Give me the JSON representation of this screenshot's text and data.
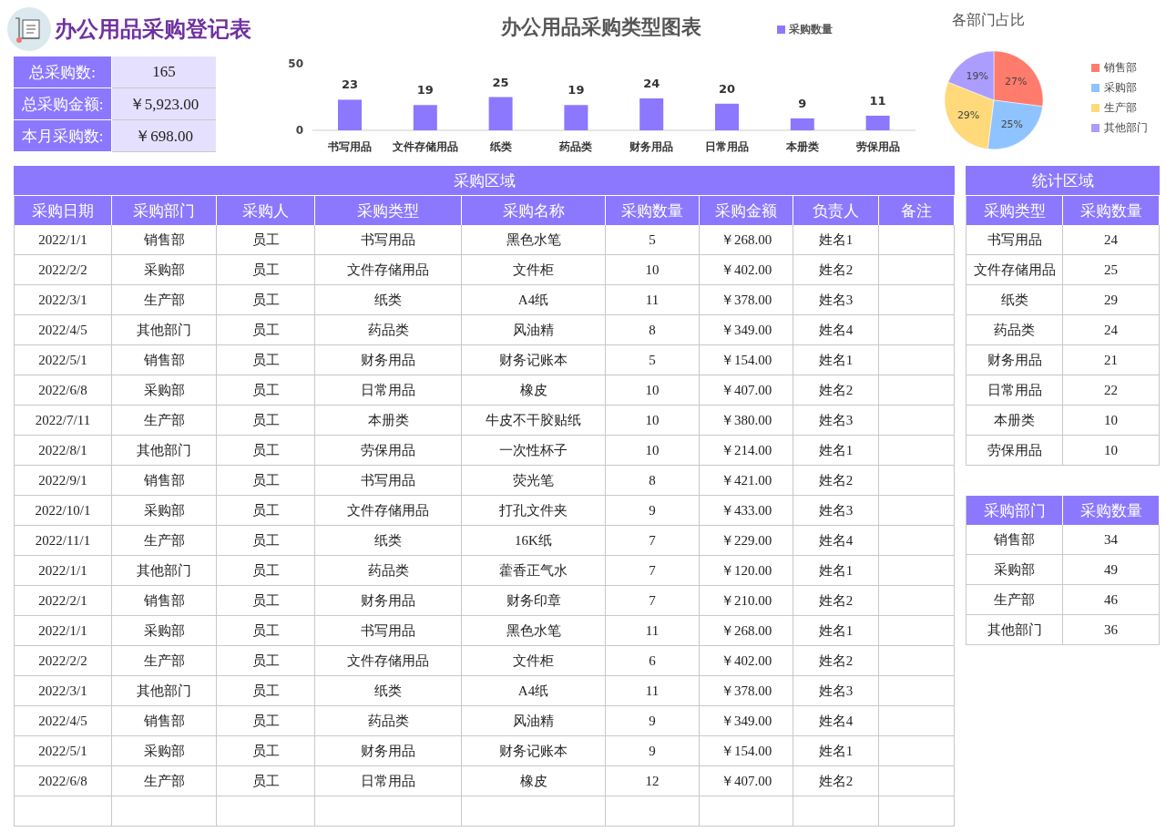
{
  "title": "办公用品采购登记表",
  "summary": [
    {
      "label": "总采购数:",
      "value": "165"
    },
    {
      "label": "总采购金额:",
      "value": "￥5,923.00"
    },
    {
      "label": "本月采购数:",
      "value": "￥698.00"
    }
  ],
  "bar_chart": {
    "chart_data": {
      "type": "bar",
      "title": "办公用品采购类型图表",
      "categories": [
        "书写用品",
        "文件存储用品",
        "纸类",
        "药品类",
        "财务用品",
        "日常用品",
        "本册类",
        "劳保用品"
      ],
      "series": [
        {
          "name": "采购数量",
          "color": "#8c78ff",
          "values": [
            23,
            19,
            25,
            19,
            24,
            20,
            9,
            11
          ]
        }
      ],
      "ylim": [
        0,
        50
      ],
      "yticks": [
        0,
        50
      ],
      "data_labels": true
    }
  },
  "pie_chart": {
    "chart_data": {
      "type": "pie",
      "title": "各部门占比",
      "categories": [
        "销售部",
        "采购部",
        "生产部",
        "其他部门"
      ],
      "values": [
        27,
        25,
        29,
        19
      ],
      "colors": [
        "#ff7b6b",
        "#8fc3ff",
        "#ffd97a",
        "#ab9cff"
      ],
      "value_labels": [
        "27%",
        "25%",
        "29%",
        "19%"
      ]
    }
  },
  "main_table": {
    "title": "采购区域",
    "columns": [
      "采购日期",
      "采购部门",
      "采购人",
      "采购类型",
      "采购名称",
      "采购数量",
      "采购金额",
      "负责人",
      "备注"
    ],
    "rows": [
      [
        "2022/1/1",
        "销售部",
        "员工",
        "书写用品",
        "黑色水笔",
        "5",
        "￥268.00",
        "姓名1"
      ],
      [
        "2022/2/2",
        "采购部",
        "员工",
        "文件存储用品",
        "文件柜",
        "10",
        "￥402.00",
        "姓名2"
      ],
      [
        "2022/3/1",
        "生产部",
        "员工",
        "纸类",
        "A4纸",
        "11",
        "￥378.00",
        "姓名3"
      ],
      [
        "2022/4/5",
        "其他部门",
        "员工",
        "药品类",
        "风油精",
        "8",
        "￥349.00",
        "姓名4"
      ],
      [
        "2022/5/1",
        "销售部",
        "员工",
        "财务用品",
        "财务记账本",
        "5",
        "￥154.00",
        "姓名1"
      ],
      [
        "2022/6/8",
        "采购部",
        "员工",
        "日常用品",
        "橡皮",
        "10",
        "￥407.00",
        "姓名2"
      ],
      [
        "2022/7/11",
        "生产部",
        "员工",
        "本册类",
        "牛皮不干胶贴纸",
        "10",
        "￥380.00",
        "姓名3"
      ],
      [
        "2022/8/1",
        "其他部门",
        "员工",
        "劳保用品",
        "一次性杯子",
        "10",
        "￥214.00",
        "姓名1"
      ],
      [
        "2022/9/1",
        "销售部",
        "员工",
        "书写用品",
        "荧光笔",
        "8",
        "￥421.00",
        "姓名2"
      ],
      [
        "2022/10/1",
        "采购部",
        "员工",
        "文件存储用品",
        "打孔文件夹",
        "9",
        "￥433.00",
        "姓名3"
      ],
      [
        "2022/11/1",
        "生产部",
        "员工",
        "纸类",
        "16K纸",
        "7",
        "￥229.00",
        "姓名4"
      ],
      [
        "2022/1/1",
        "其他部门",
        "员工",
        "药品类",
        "藿香正气水",
        "7",
        "￥120.00",
        "姓名1"
      ],
      [
        "2022/2/1",
        "销售部",
        "员工",
        "财务用品",
        "财务印章",
        "7",
        "￥210.00",
        "姓名2"
      ],
      [
        "2022/1/1",
        "采购部",
        "员工",
        "书写用品",
        "黑色水笔",
        "11",
        "￥268.00",
        "姓名1"
      ],
      [
        "2022/2/2",
        "生产部",
        "员工",
        "文件存储用品",
        "文件柜",
        "6",
        "￥402.00",
        "姓名2"
      ],
      [
        "2022/3/1",
        "其他部门",
        "员工",
        "纸类",
        "A4纸",
        "11",
        "￥378.00",
        "姓名3"
      ],
      [
        "2022/4/5",
        "销售部",
        "员工",
        "药品类",
        "风油精",
        "9",
        "￥349.00",
        "姓名4"
      ],
      [
        "2022/5/1",
        "采购部",
        "员工",
        "财务用品",
        "财务记账本",
        "9",
        "￥154.00",
        "姓名1"
      ],
      [
        "2022/6/8",
        "生产部",
        "员工",
        "日常用品",
        "橡皮",
        "12",
        "￥407.00",
        "姓名2"
      ]
    ]
  },
  "type_stats": {
    "title": "统计区域",
    "columns": [
      "采购类型",
      "采购数量"
    ],
    "rows": [
      [
        "书写用品",
        "24"
      ],
      [
        "文件存储用品",
        "25"
      ],
      [
        "纸类",
        "29"
      ],
      [
        "药品类",
        "24"
      ],
      [
        "财务用品",
        "21"
      ],
      [
        "日常用品",
        "22"
      ],
      [
        "本册类",
        "10"
      ],
      [
        "劳保用品",
        "10"
      ]
    ]
  },
  "dept_stats": {
    "columns": [
      "采购部门",
      "采购数量"
    ],
    "rows": [
      [
        "销售部",
        "34"
      ],
      [
        "采购部",
        "49"
      ],
      [
        "生产部",
        "46"
      ],
      [
        "其他部门",
        "36"
      ]
    ]
  }
}
